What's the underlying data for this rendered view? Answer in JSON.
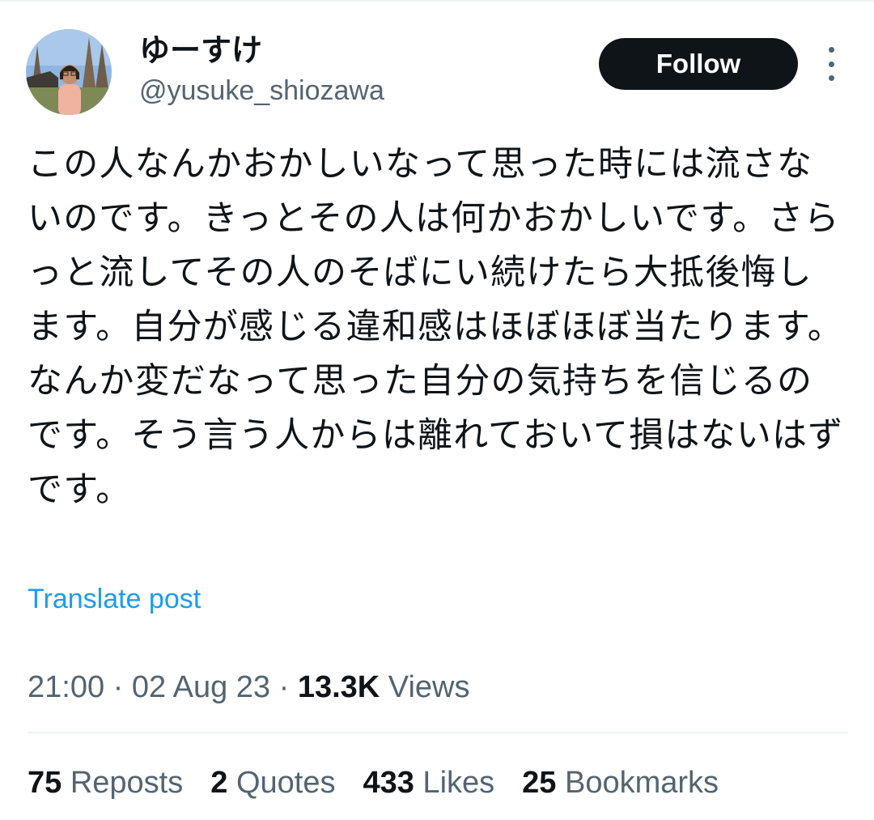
{
  "author": {
    "display_name": "ゆーすけ",
    "handle": "@yusuke_shiozawa",
    "avatar_icon": "user-avatar-photo"
  },
  "header": {
    "follow_label": "Follow",
    "more_icon": "more-vertical-icon"
  },
  "post": {
    "text": "この人なんかおかしいなって思った時には流さないのです。きっとその人は何かおかしいです。さらっと流してその人のそばにい続けたら大抵後悔します。自分が感じる違和感はほぼほぼ当たります。なんか変だなって思った自分の気持ちを信じるのです。そう言う人からは離れておいて損はないはずです。",
    "translate_label": "Translate post"
  },
  "meta": {
    "time": "21:00",
    "separator": " · ",
    "date": "02 Aug 23",
    "views_count": "13.3K",
    "views_label": " Views"
  },
  "stats": [
    {
      "count": "75",
      "label": " Reposts"
    },
    {
      "count": "2",
      "label": " Quotes"
    },
    {
      "count": "433",
      "label": " Likes"
    },
    {
      "count": "25",
      "label": " Bookmarks"
    }
  ],
  "colors": {
    "text_primary": "#0f1419",
    "text_secondary": "#536471",
    "link": "#1d9bf0",
    "button_bg": "#0f1419",
    "divider": "#eff3f4"
  }
}
